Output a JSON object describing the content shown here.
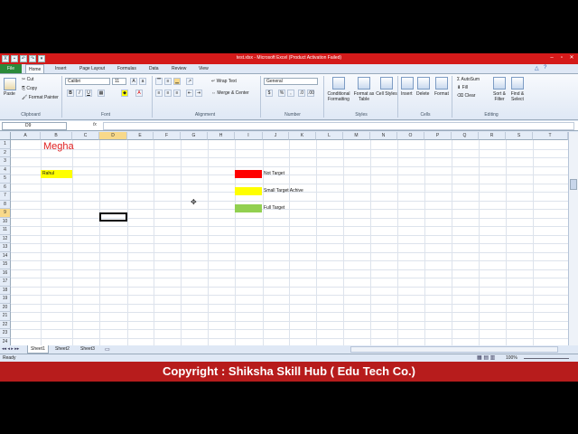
{
  "window": {
    "title": "test.xlsx - Microsoft Excel (Product Activation Failed)"
  },
  "ribbon_tabs": [
    "File",
    "Home",
    "Insert",
    "Page Layout",
    "Formulas",
    "Data",
    "Review",
    "View"
  ],
  "active_tab": "Home",
  "clipboard": {
    "cut": "Cut",
    "copy": "Copy",
    "format_painter": "Format Painter",
    "paste": "Paste",
    "label": "Clipboard"
  },
  "font": {
    "name": "Calibri",
    "size": "11",
    "bold": "B",
    "italic": "I",
    "underline": "U",
    "label": "Font"
  },
  "alignment": {
    "wrap_text": "Wrap Text",
    "merge_center": "Merge & Center",
    "label": "Alignment"
  },
  "number": {
    "format": "General",
    "currency": "$",
    "percent": "%",
    "comma": ",",
    "label": "Number"
  },
  "styles": {
    "conditional": "Conditional Formatting",
    "format_table": "Format as Table",
    "cell_styles": "Cell Styles",
    "label": "Styles"
  },
  "cells_group": {
    "insert": "Insert",
    "delete": "Delete",
    "format": "Format",
    "label": "Cells"
  },
  "editing": {
    "autosum": "AutoSum",
    "fill": "Fill",
    "clear": "Clear",
    "sort_filter": "Sort & Filter",
    "find_select": "Find & Select",
    "label": "Editing"
  },
  "formula_bar": {
    "name_box": "D9",
    "fx": "fx",
    "value": ""
  },
  "columns": [
    "A",
    "B",
    "C",
    "D",
    "E",
    "F",
    "G",
    "H",
    "I",
    "J",
    "K",
    "L",
    "M",
    "N",
    "O",
    "P",
    "Q",
    "R",
    "S",
    "T"
  ],
  "rows": [
    "1",
    "2",
    "3",
    "4",
    "5",
    "6",
    "7",
    "8",
    "9",
    "10",
    "11",
    "12",
    "13",
    "14",
    "15",
    "16",
    "17",
    "18",
    "19",
    "20",
    "21",
    "22",
    "23",
    "24"
  ],
  "selected_cell": "D9",
  "cells": {
    "title": "Megha",
    "rahul": "Rahul",
    "legend_red": "Not Target",
    "legend_yellow": "Small Target Achive",
    "legend_green": "Full Target"
  },
  "colors": {
    "title_red": "#e02020",
    "fill_red": "#ff0000",
    "fill_yellow": "#ffff00",
    "fill_green": "#92d050"
  },
  "sheets": [
    "Sheet1",
    "Sheet2",
    "Sheet3"
  ],
  "active_sheet": "Sheet1",
  "status": {
    "ready": "Ready",
    "zoom": "100%"
  },
  "footer_text": "Copyright : Shiksha Skill Hub ( Edu Tech Co.)"
}
